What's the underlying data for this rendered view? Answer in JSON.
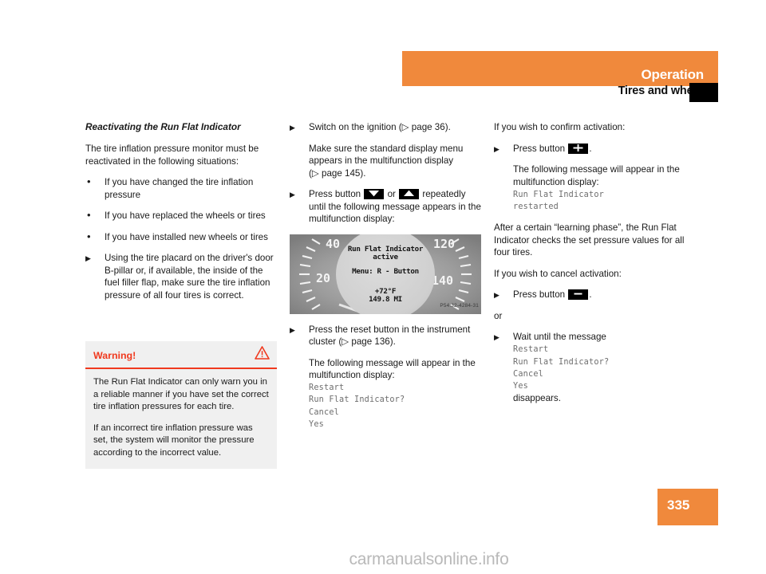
{
  "header": {
    "title": "Operation",
    "subtitle": "Tires and wheels",
    "bar_color": "#f0893c",
    "marker_color": "#000000"
  },
  "page": {
    "number": "335",
    "badge_color": "#f0893c"
  },
  "watermark": "carmanualsonline.info",
  "left_column": {
    "section_title": "Reactivating the Run Flat Indicator",
    "intro": "The tire inflation pressure monitor must be reactivated in the following situations:",
    "bullets": [
      "If you have changed the tire inflation pressure",
      "If you have replaced the wheels or tires",
      "If you have installed new wheels or tires"
    ],
    "action": "Using the tire placard on the driver's door B-pillar or, if available, the inside of the fuel filler flap, make sure the tire inflation pressure of all four tires is correct."
  },
  "warning": {
    "title": "Warning!",
    "icon": "warning-triangle-icon",
    "accent_color": "#f0391e",
    "background_color": "#f0f0f0",
    "paragraphs": [
      "The Run Flat Indicator can only warn you in a reliable manner if you have set the correct tire inflation pressures for each tire.",
      "If an incorrect tire inflation pressure was set, the system will monitor the pressure according to the incorrect value."
    ]
  },
  "middle_column": {
    "step1": "Switch on the ignition (",
    "step1_ref": "page 36",
    "step1_end": ").",
    "note1_a": "Make sure the standard display menu appears in the multifunction display (",
    "note1_ref": "page 145",
    "note1_end": ").",
    "step2_a": "Press button",
    "step2_or": "or",
    "step2_b": "repeatedly until the following message appears in the multifunction display:",
    "step2_btn_down": "down-arrow-button-icon",
    "step2_btn_up": "up-arrow-button-icon",
    "figure": {
      "name": "instrument-cluster-display",
      "code": "P54.32-4284-31",
      "display_lines": [
        "Run Flat Indicator",
        "active",
        "Menu: R - Button",
        "+72°F",
        "149.8 MI"
      ],
      "gauge_labels": [
        "40",
        "20",
        "120",
        "140"
      ]
    },
    "step3_a": "Press the reset button in the instrument cluster (",
    "step3_ref": "page 136",
    "step3_end": ").",
    "note3": "The following message will appear in the multifunction display:",
    "message_lines": [
      "Restart",
      "Run Flat Indicator?",
      "Cancel",
      "Yes"
    ]
  },
  "right_column": {
    "confirm_heading": "If you wish to confirm activation:",
    "confirm_step_a": "Press button",
    "confirm_step_btn": "plus-button-icon",
    "confirm_step_end": ".",
    "confirm_note": "The following message will appear in the multifunction display:",
    "confirm_message_lines": [
      "Run Flat Indicator",
      "restarted"
    ],
    "learning_phase": "After a certain “learning phase”, the Run Flat Indicator checks the set pressure values for all four tires.",
    "cancel_heading": "If you wish to cancel activation:",
    "cancel_step_a": "Press button",
    "cancel_step_btn": "minus-button-icon",
    "cancel_step_end": ".",
    "or_label": "or",
    "wait_step": "Wait until the message",
    "wait_message_lines": [
      "Restart",
      "Run Flat Indicator?",
      "Cancel",
      "Yes"
    ],
    "wait_step_end": "disappears."
  }
}
